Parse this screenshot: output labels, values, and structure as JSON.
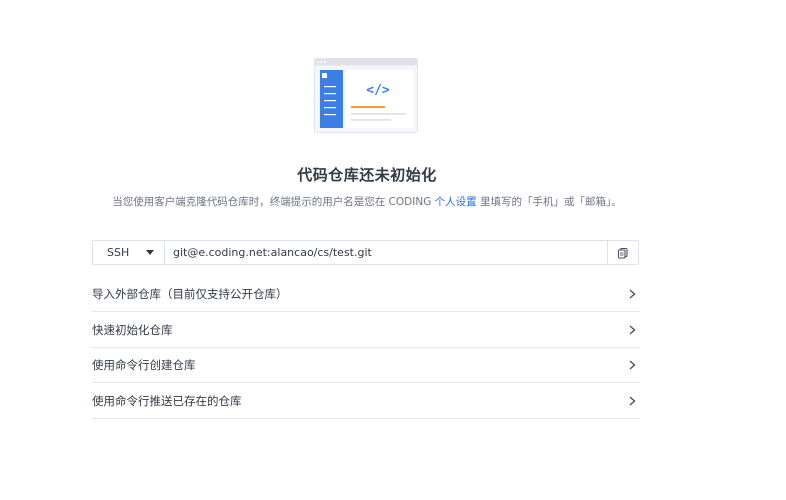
{
  "empty_state": {
    "title": "代码仓库还未初始化",
    "desc_before": "当您使用客户端克隆代码仓库时，终端提示的用户名是您在 CODING ",
    "desc_link": "个人设置",
    "desc_after": " 里填写的「手机」或「邮箱」。"
  },
  "clone": {
    "protocol": "SSH",
    "url": "git@e.coding.net:alancao/cs/test.git",
    "copy_icon": "copy-icon"
  },
  "options": [
    {
      "label": "导入外部仓库（目前仅支持公开仓库）"
    },
    {
      "label": "快速初始化仓库"
    },
    {
      "label": "使用命令行创建仓库"
    },
    {
      "label": "使用命令行推送已存在的仓库"
    }
  ],
  "colors": {
    "accent": "#2a6fdb",
    "sidebar_blue": "#3a7ee6",
    "orange": "#f0a13a"
  }
}
